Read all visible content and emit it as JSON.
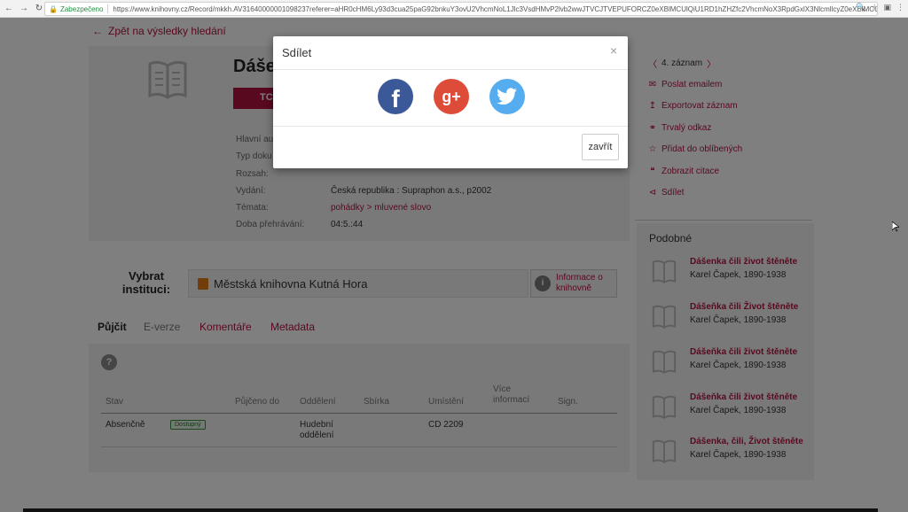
{
  "browser": {
    "secure_label": "Zabezpečeno",
    "url": "https://www.knihovny.cz/Record/mkkh.AV31640000001098237referer=aHR0cHM6Ly93d3cua25paG92bnkuY3ovU2VhcmNoL1Jlc3VsdHMvP2lvb2wwJTVCJTVEPUFORCZ0eXBlMCUlQiU1RD1hZHZfc2VhcmNoX3RpdGxlX3NlcmllcyZ0eXBlMCUlQiU1RD1hZHZfc..."
  },
  "page": {
    "back_link": "Zpět na výsledky hledání",
    "title": "Dášeň",
    "red_bar": "TC",
    "meta_labels": [
      "Hlavní au",
      "Typ doku",
      "Rozsah:",
      "Vydání:",
      "Témata:",
      "Doba přehrávání:"
    ],
    "meta_values": {
      "vydani": "Česká republika : Supraphon a.s., p2002",
      "temata_1": "pohádky",
      "temata_sep": ">",
      "temata_2": "mluvené slovo",
      "doba": "04:5.:44"
    },
    "side": {
      "count": "4. záznam",
      "links": [
        "Poslat emailem",
        "Exportovat záznam",
        "Trvalý odkaz",
        "Přidat do oblíbených",
        "Zobrazit citace",
        "Sdílet"
      ]
    },
    "podobne": {
      "title": "Podobné",
      "items": [
        {
          "title": "Dášenka čili život štěněte",
          "author": "Karel Čapek, 1890-1938"
        },
        {
          "title": "Dášeňka čili Život štěněte",
          "author": "Karel Čapek, 1890-1938"
        },
        {
          "title": "Dášeňka čili život štěněte",
          "author": "Karel Čapek, 1890-1938"
        },
        {
          "title": "Dášeňka čili život štěněte",
          "author": "Karel Čapek, 1890-1938"
        },
        {
          "title": "Dášenka, čili, Život štěněte",
          "author": "Karel Čapek, 1890-1938"
        }
      ]
    },
    "institution": {
      "label_1": "Vybrat",
      "label_2": "instituci:",
      "selected": "Městská knihovna Kutná Hora",
      "info_1": "Informace o",
      "info_2": "knihovně"
    },
    "tabs": [
      "Půjčit",
      "E-verze",
      "Komentáře",
      "Metadata"
    ],
    "table": {
      "headers": [
        "Stav",
        "Půjčeno do",
        "Oddělení",
        "Sbírka",
        "Umístění",
        "Více informací",
        "Sign."
      ],
      "row": {
        "stav": "Absenčně",
        "badge": "Dostupný",
        "oddeleni": "Hudební oddělení",
        "umisteni": "CD 2209"
      }
    }
  },
  "modal": {
    "title": "Sdílet",
    "close_x": "×",
    "close_button": "zavřít"
  },
  "colors": {
    "accent": "#b3133e",
    "facebook": "#3b5998",
    "googleplus": "#dd4b39",
    "twitter": "#55acee"
  }
}
